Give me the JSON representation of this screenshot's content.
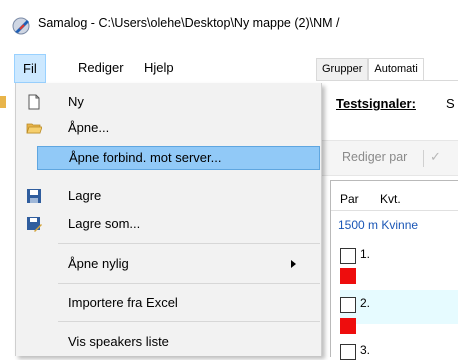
{
  "window": {
    "title": "Samalog - C:\\Users\\olehe\\Desktop\\Ny mappe (2)\\NM /"
  },
  "menubar": {
    "items": [
      {
        "label": "Fil"
      },
      {
        "label": "Rediger"
      },
      {
        "label": "Hjelp"
      }
    ]
  },
  "tabs": [
    {
      "label": "Grupper"
    },
    {
      "label": "Automati"
    }
  ],
  "panel": {
    "testsignaler_label": "Testsignaler:",
    "testsignaler_value": "S"
  },
  "toolbar": {
    "rediger_par": "Rediger par"
  },
  "grid": {
    "columns": [
      "Par",
      "Kvt."
    ],
    "event": "1500 m Kvinne",
    "rows": [
      "1.",
      "2.",
      "3."
    ]
  },
  "file_menu": {
    "items": [
      {
        "label": "Ny",
        "icon": "new-file-icon"
      },
      {
        "label": "Åpne...",
        "icon": "open-folder-icon"
      },
      {
        "label": "Åpne forbind. mot server...",
        "icon": null,
        "highlighted": true
      },
      {
        "label": "Lagre",
        "icon": "save-icon"
      },
      {
        "label": "Lagre som...",
        "icon": "save-as-icon"
      },
      {
        "label": "Åpne nylig",
        "submenu": true
      },
      {
        "label": "Importere fra Excel"
      },
      {
        "label": "Vis speakers liste"
      }
    ]
  },
  "colors": {
    "menu_highlight": "#91c9f7",
    "active_menu": "#cce8ff",
    "link_blue": "#1a56b6",
    "status_red": "#ee0d0d"
  }
}
